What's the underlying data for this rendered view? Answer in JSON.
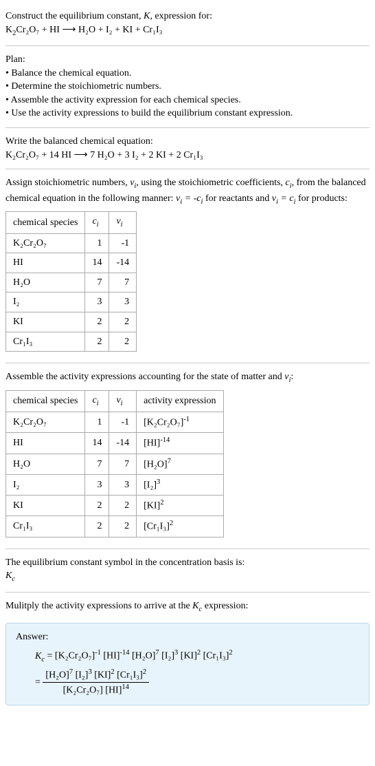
{
  "intro": {
    "line1_a": "Construct the equilibrium constant, ",
    "line1_b": ", expression for:",
    "eq_lhs": "K",
    "eq_rest": "Cr₂O₇ + HI ⟶ H₂O + I₂ + KI + Cr₁I₃"
  },
  "plan": {
    "title": "Plan:",
    "b1": "• Balance the chemical equation.",
    "b2": "• Determine the stoichiometric numbers.",
    "b3": "• Assemble the activity expression for each chemical species.",
    "b4": "• Use the activity expressions to build the equilibrium constant expression."
  },
  "balanced": {
    "title": "Write the balanced chemical equation:",
    "eq": "K₂Cr₂O₇ + 14 HI ⟶ 7 H₂O + 3 I₂ + 2 KI + 2 Cr₁I₃"
  },
  "stoich": {
    "p1_a": "Assign stoichiometric numbers, ",
    "p1_b": ", using the stoichiometric coefficients, ",
    "p1_c": ", from the balanced chemical equation in the following manner: ",
    "p1_d": " for reactants and ",
    "p1_e": " for products:",
    "headers": {
      "h1": "chemical species",
      "h2": "cᵢ",
      "h3": "νᵢ"
    },
    "rows": [
      {
        "sp": "K₂Cr₂O₇",
        "c": "1",
        "v": "-1"
      },
      {
        "sp": "HI",
        "c": "14",
        "v": "-14"
      },
      {
        "sp": "H₂O",
        "c": "7",
        "v": "7"
      },
      {
        "sp": "I₂",
        "c": "3",
        "v": "3"
      },
      {
        "sp": "KI",
        "c": "2",
        "v": "2"
      },
      {
        "sp": "Cr₁I₃",
        "c": "2",
        "v": "2"
      }
    ]
  },
  "activity": {
    "title_a": "Assemble the activity expressions accounting for the state of matter and ",
    "title_b": ":",
    "headers": {
      "h1": "chemical species",
      "h2": "cᵢ",
      "h3": "νᵢ",
      "h4": "activity expression"
    },
    "rows": [
      {
        "sp": "K₂Cr₂O₇",
        "c": "1",
        "v": "-1",
        "ae_base": "[K₂Cr₂O₇]",
        "ae_exp": "-1"
      },
      {
        "sp": "HI",
        "c": "14",
        "v": "-14",
        "ae_base": "[HI]",
        "ae_exp": "-14"
      },
      {
        "sp": "H₂O",
        "c": "7",
        "v": "7",
        "ae_base": "[H₂O]",
        "ae_exp": "7"
      },
      {
        "sp": "I₂",
        "c": "3",
        "v": "3",
        "ae_base": "[I₂]",
        "ae_exp": "3"
      },
      {
        "sp": "KI",
        "c": "2",
        "v": "2",
        "ae_base": "[KI]",
        "ae_exp": "2"
      },
      {
        "sp": "Cr₁I₃",
        "c": "2",
        "v": "2",
        "ae_base": "[Cr₁I₃]",
        "ae_exp": "2"
      }
    ]
  },
  "symbol": {
    "line1": "The equilibrium constant symbol in the concentration basis is:",
    "line2_a": "K",
    "line2_b": "c"
  },
  "multiply": {
    "text_a": "Mulitply the activity expressions to arrive at the ",
    "text_b": " expression:"
  },
  "answer": {
    "label": "Answer:",
    "kc": "K",
    "ksub": "c",
    "eq": " = ",
    "line1_parts": {
      "p1": "[K₂Cr₂O₇]",
      "e1": "-1",
      "p2": " [HI]",
      "e2": "-14",
      "p3": " [H₂O]",
      "e3": "7",
      "p4": " [I₂]",
      "e4": "3",
      "p5": " [KI]",
      "e5": "2",
      "p6": " [Cr₁I₃]",
      "e6": "2"
    },
    "frac_num": {
      "p1": "[H₂O]",
      "e1": "7",
      "p2": " [I₂]",
      "e2": "3",
      "p3": " [KI]",
      "e3": "2",
      "p4": " [Cr₁I₃]",
      "e4": "2"
    },
    "frac_den": {
      "p1": "[K₂Cr₂O₇] [HI]",
      "e1": "14"
    }
  }
}
